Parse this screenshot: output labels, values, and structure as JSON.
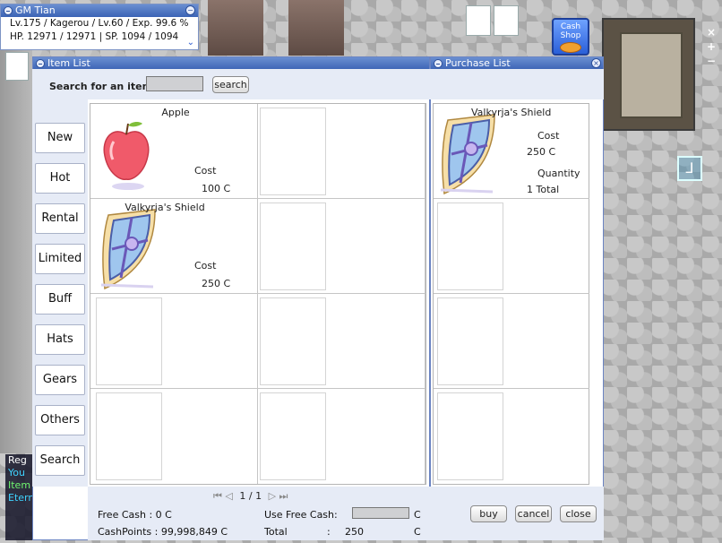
{
  "status": {
    "title": "GM Tian",
    "line1": "Lv.175 / Kagerou / Lv.60 / Exp. 99.6 %",
    "line2": "HP. 12971 / 12971 | SP. 1094 / 1094"
  },
  "cash_shop_icon": {
    "label": "Cash Shop"
  },
  "item_list": {
    "title": "Item List",
    "search_label": "Search for an item:",
    "search_value": "",
    "search_button": "search",
    "categories": [
      "New",
      "Hot",
      "Rental",
      "Limited",
      "Buff",
      "Hats",
      "Gears",
      "Others",
      "Search"
    ],
    "items": [
      {
        "name": "Apple",
        "cost_label": "Cost",
        "cost": "100 C"
      },
      {
        "name": "Valkyrja's Shield",
        "cost_label": "Cost",
        "cost": "250 C"
      }
    ],
    "pagination": "1 / 1"
  },
  "purchase_list": {
    "title": "Purchase List",
    "items": [
      {
        "name": "Valkyrja's Shield",
        "cost_label": "Cost",
        "cost": "250 C",
        "quantity_label": "Quantity",
        "quantity": "1 Total"
      }
    ]
  },
  "footer": {
    "free_cash": "Free Cash : 0 C",
    "use_free_cash_label": "Use Free Cash:",
    "use_free_cash_unit": "C",
    "cash_points": "CashPoints : 99,998,849 C",
    "total_label": "Total",
    "total_sep": ":",
    "total_value": "250",
    "total_unit": "C",
    "buy": "buy",
    "cancel": "cancel",
    "close": "close"
  },
  "chat": {
    "lines": [
      "Reg",
      "You",
      "Item",
      "Etern"
    ]
  },
  "colors": {
    "title_bar": "#3b63b5",
    "panel_bg": "#e6ebf6",
    "chat_text": "#3fd3ff"
  }
}
